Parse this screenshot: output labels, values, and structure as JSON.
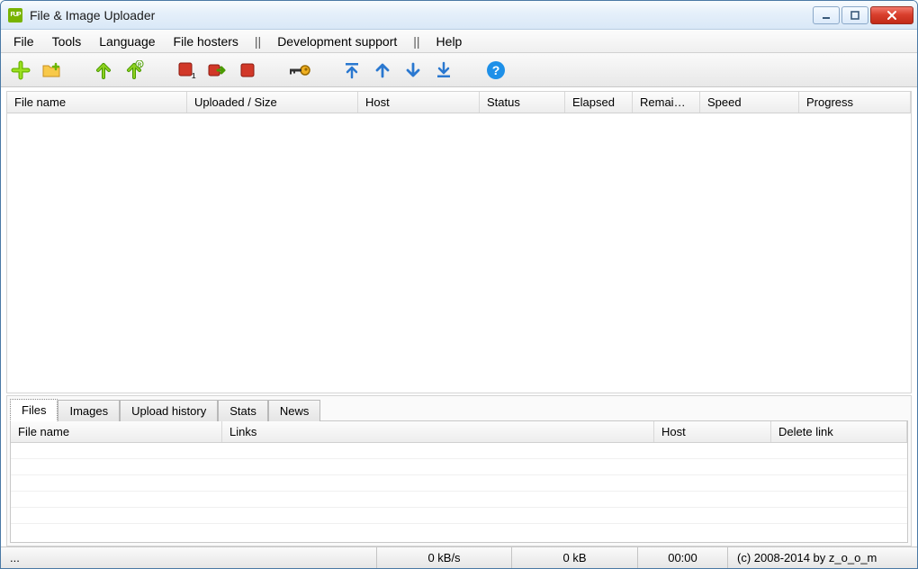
{
  "window": {
    "title": "File & Image Uploader",
    "icon_text": "FUP"
  },
  "menu": {
    "file": "File",
    "tools": "Tools",
    "language": "Language",
    "filehosters": "File hosters",
    "devsupport": "Development support",
    "help": "Help",
    "sep": "||"
  },
  "toolbar": {
    "add": "add",
    "add_folder": "add-folder",
    "upload": "upload",
    "upload_all": "upload-all",
    "remove_one": "remove-one",
    "retry": "retry",
    "stop": "stop",
    "account": "account",
    "move_top": "move-top",
    "move_up": "move-up",
    "move_down": "move-down",
    "move_bottom": "move-bottom",
    "help": "help"
  },
  "upper_columns": {
    "filename": "File name",
    "uploaded_size": "Uploaded / Size",
    "host": "Host",
    "status": "Status",
    "elapsed": "Elapsed",
    "remaining": "Remai…",
    "speed": "Speed",
    "progress": "Progress"
  },
  "tabs": {
    "files": "Files",
    "images": "Images",
    "upload_history": "Upload history",
    "stats": "Stats",
    "news": "News"
  },
  "lower_columns": {
    "filename": "File name",
    "links": "Links",
    "host": "Host",
    "delete_link": "Delete link"
  },
  "status": {
    "left": "...",
    "speed": "0 kB/s",
    "size": "0 kB",
    "time": "00:00",
    "copyright": "(c) 2008-2014 by z_o_o_m"
  }
}
